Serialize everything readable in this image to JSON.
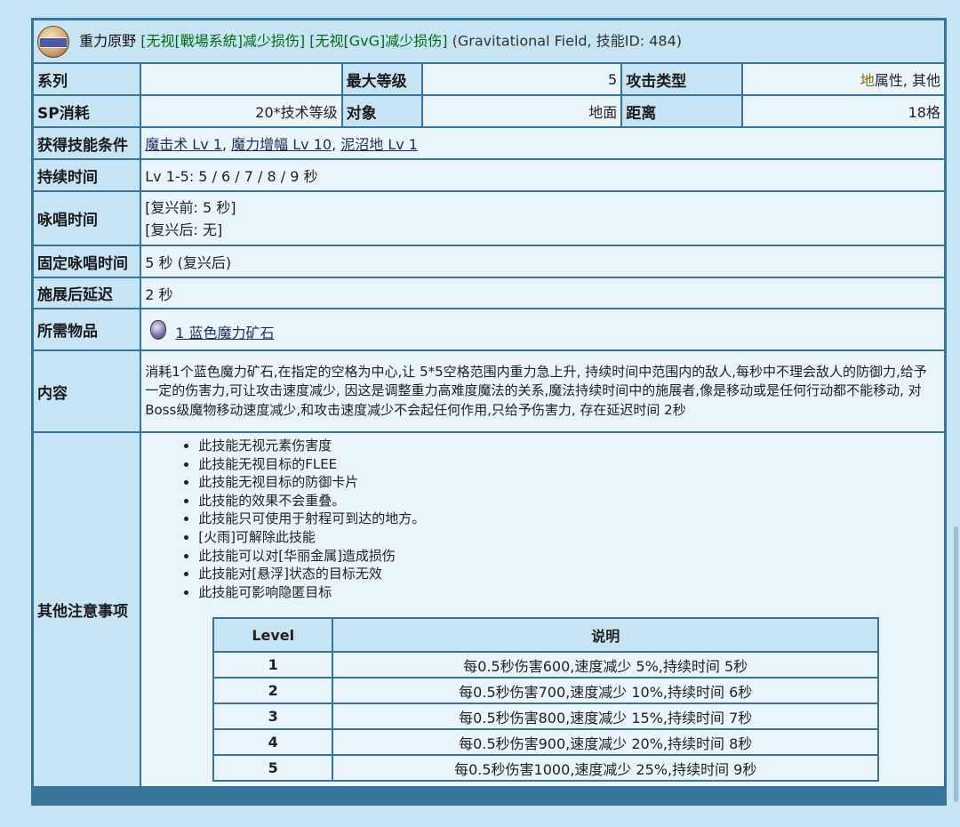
{
  "title": {
    "name": "重力原野",
    "tag1": "[无视[戰場系統]减少损伤]",
    "tag2": "[无视[GvG]减少损伤]",
    "meta": "(Gravitational Field, 技能ID: 484)"
  },
  "row_series": {
    "label": "系列",
    "value": "",
    "max_level_label": "最大等级",
    "max_level": "5",
    "attack_type_label": "攻击类型",
    "element": "地",
    "attack_type_rest": "属性, 其他"
  },
  "row_sp": {
    "label": "SP消耗",
    "value": "20*技术等级",
    "target_label": "对象",
    "target": "地面",
    "range_label": "距离",
    "range": "18格"
  },
  "requirements": {
    "label": "获得技能条件",
    "skills": [
      "魔击术 Lv 1",
      "魔力增幅 Lv 10",
      "泥沼地 Lv 1"
    ],
    "sep": ", "
  },
  "duration": {
    "label": "持续时间",
    "value": "Lv 1-5: 5 / 6 / 7 / 8 / 9 秒"
  },
  "cast_time": {
    "label": "咏唱时间",
    "line1": "[复兴前: 5 秒]",
    "line2": "[复兴后: 无]"
  },
  "fixed_cast": {
    "label": "固定咏唱时间",
    "value": "5 秒 (复兴后)"
  },
  "after_delay": {
    "label": "施展后延迟",
    "value": "2 秒"
  },
  "items": {
    "label": "所需物品",
    "value": "1 蓝色魔力矿石",
    "icon": "blue-gemstone-icon"
  },
  "content": {
    "label": "内容",
    "text": "消耗1个蓝色魔力矿石,在指定的空格为中心,让 5*5空格范围内重力急上升, 持续时间中范围内的敌人,每秒中不理会敌人的防御力,给予一定的伤害力,可让攻击速度减少, 因这是调整重力高难度魔法的关系,魔法持续时间中的施展者,像是移动或是任何行动都不能移动, 对Boss级魔物移动速度减少,和攻击速度减少不会起任何作用,只给予伤害力, 存在延迟时间 2秒"
  },
  "notes": {
    "label": "其他注意事项",
    "items": [
      "此技能无视元素伤害度",
      "此技能无视目标的FLEE",
      "此技能无视目标的防御卡片",
      "此技能的效果不会重叠。",
      "此技能只可使用于射程可到达的地方。",
      "[火雨]可解除此技能",
      "此技能可以对[华丽金属]造成损伤",
      "此技能对[悬浮]状态的目标无效",
      "此技能可影响隐匿目标"
    ],
    "table": {
      "headers": [
        "Level",
        "说明"
      ],
      "rows": [
        [
          "1",
          "每0.5秒伤害600,速度减少 5%,持续时间 5秒"
        ],
        [
          "2",
          "每0.5秒伤害700,速度减少 10%,持续时间 6秒"
        ],
        [
          "3",
          "每0.5秒伤害800,速度减少 15%,持续时间 7秒"
        ],
        [
          "4",
          "每0.5秒伤害900,速度减少 20%,持续时间 8秒"
        ],
        [
          "5",
          "每0.5秒伤害1000,速度减少 25%,持续时间 9秒"
        ]
      ]
    }
  },
  "colors": {
    "background": "#c6e4f4",
    "border": "#36749a",
    "header_cell": "#c7e4f5",
    "value_cell": "#e9f4fb",
    "tag_green": "#006c12",
    "element_gold": "#8a6a00"
  }
}
